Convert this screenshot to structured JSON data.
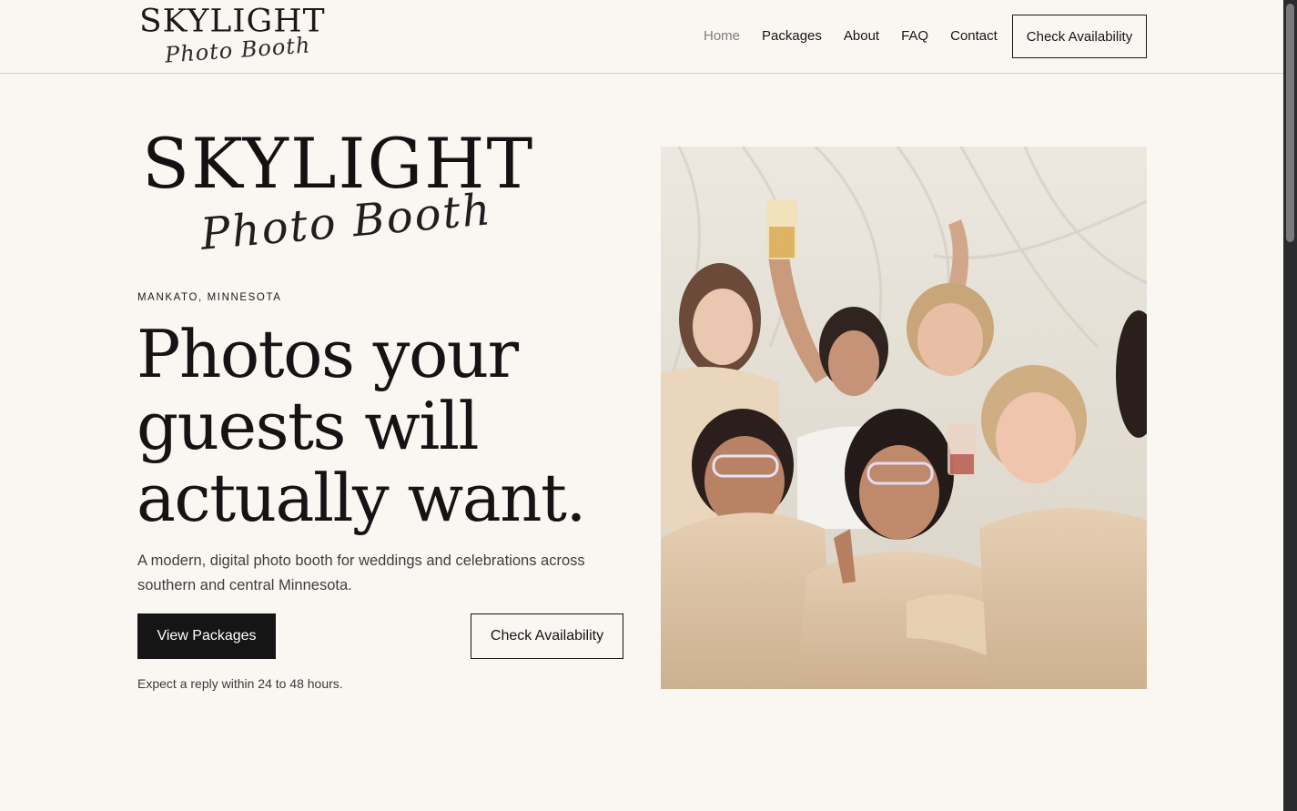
{
  "header": {
    "logo_word": "SKYLIGHT",
    "logo_script": "Photo Booth",
    "nav": [
      "Home",
      "Packages",
      "About",
      "FAQ",
      "Contact"
    ],
    "cta": "Check Availability"
  },
  "hero": {
    "logo_word": "SKYLIGHT",
    "logo_script": "Photo Booth",
    "location": "MANKATO, MINNESOTA",
    "headline": "Photos your guests will actually want.",
    "subhead": "A modern, digital photo booth for weddings and celebrations across southern and central Minnesota.",
    "primary_button": "View Packages",
    "secondary_button": "Check Availability",
    "reply_note": "Expect a reply within 24 to 48 hours."
  },
  "colors": {
    "background": "#faf7f3",
    "text": "#161616",
    "button_dark": "#151515"
  }
}
